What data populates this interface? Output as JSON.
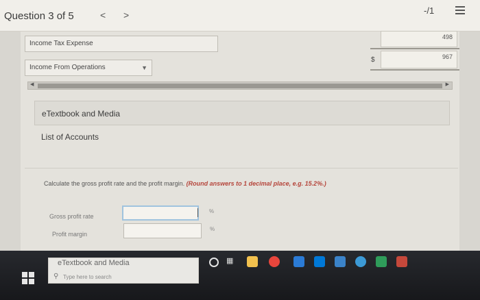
{
  "header": {
    "question_label": "Question 3 of 5",
    "prev_symbol": "<",
    "next_symbol": ">",
    "score": "-/1"
  },
  "statement": {
    "row1_label": "Income Tax Expense",
    "row1_amount": "498",
    "row2_label": "Income From Operations",
    "row2_amount": "967",
    "currency_symbol": "$"
  },
  "resources": {
    "etextbook_label": "eTextbook and Media",
    "accounts_label": "List of Accounts"
  },
  "question": {
    "instruction": "Calculate the gross profit rate and the profit margin.",
    "instruction_note": "(Round answers to 1 decimal place, e.g. 15.2%.)",
    "gross_label": "Gross profit rate",
    "gross_value": "",
    "gross_unit": "%",
    "profit_label": "Profit margin",
    "profit_value": "",
    "profit_unit": "%",
    "bottom_link": "eTextbook and Media"
  },
  "taskbar": {
    "search_placeholder": "Type here to search",
    "icons": [
      "windows-start-icon",
      "search-icon",
      "cortana-icon",
      "task-view-icon",
      "file-explorer-icon",
      "chrome-icon",
      "app-icon",
      "store-icon",
      "mail-icon",
      "edge-icon",
      "app-icon-2",
      "app-icon-3"
    ],
    "icon_colors": [
      "#e6e6e6",
      "#888888",
      "#e6e6e6",
      "#dddddd",
      "#f2c14e",
      "#e8453c",
      "#2b7bd6",
      "#0078d7",
      "#3b83c9",
      "#3c9ad6",
      "#2f9c5a",
      "#c5483b"
    ]
  }
}
